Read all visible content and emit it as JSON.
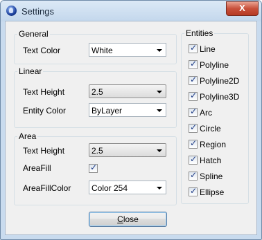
{
  "window": {
    "title": "Settings",
    "close_glyph": "X"
  },
  "general": {
    "label": "General",
    "text_color_label": "Text Color",
    "text_color_value": "White"
  },
  "linear": {
    "label": "Linear",
    "text_height_label": "Text Height",
    "text_height_value": "2.5",
    "entity_color_label": "Entity Color",
    "entity_color_value": "ByLayer"
  },
  "area": {
    "label": "Area",
    "text_height_label": "Text Height",
    "text_height_value": "2.5",
    "areafill_label": "AreaFill",
    "areafill_checked": true,
    "areafill_color_label": "AreaFillColor",
    "areafill_color_value": "Color 254"
  },
  "entities": {
    "label": "Entities",
    "items": [
      {
        "label": "Line",
        "checked": true
      },
      {
        "label": "Polyline",
        "checked": true
      },
      {
        "label": "Polyline2D",
        "checked": true
      },
      {
        "label": "Polyline3D",
        "checked": true
      },
      {
        "label": "Arc",
        "checked": true
      },
      {
        "label": "Circle",
        "checked": true
      },
      {
        "label": "Region",
        "checked": true
      },
      {
        "label": "Hatch",
        "checked": true
      },
      {
        "label": "Spline",
        "checked": true
      },
      {
        "label": "Ellipse",
        "checked": true
      }
    ]
  },
  "buttons": {
    "close_mnemonic": "C",
    "close_rest": "lose"
  }
}
